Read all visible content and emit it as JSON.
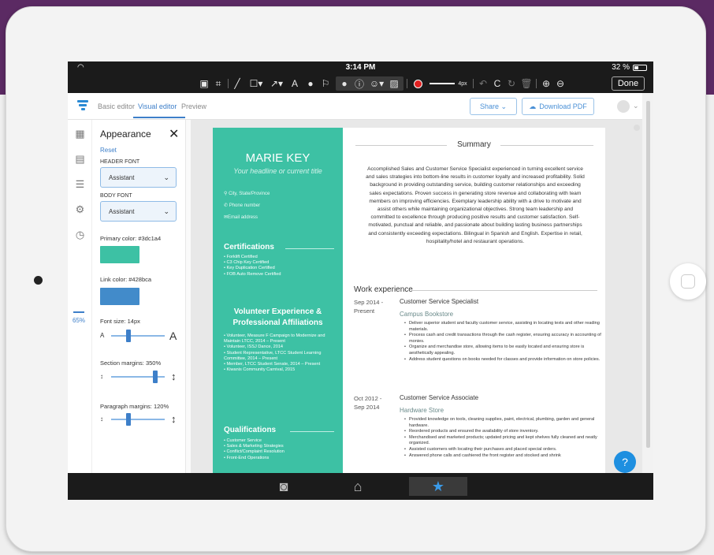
{
  "status": {
    "time": "3:14 PM",
    "battery": "32 %"
  },
  "toolbar": {
    "tools": [
      "select-icon",
      "crop-icon",
      "pen-icon",
      "rect-icon",
      "arrow-icon",
      "text-icon",
      "fill-icon",
      "highlight-icon",
      "comment-icon",
      "info-icon",
      "emoji-icon",
      "image-icon",
      "color-icon",
      "stroke-icon",
      "undo-icon",
      "redo-icon",
      "rotate-icon",
      "trash-icon",
      "zoom-in-icon",
      "zoom-out-icon"
    ],
    "stroke_label": "4px",
    "done_label": "Done",
    "accent_color": "#e02020"
  },
  "app": {
    "tabs": [
      "Basic editor",
      "Visual editor",
      "Preview"
    ],
    "share_label": "Share",
    "download_label": "Download PDF"
  },
  "rail": {
    "zoom": "65%"
  },
  "panel": {
    "title": "Appearance",
    "reset": "Reset",
    "header_font_label": "HEADER FONT",
    "header_font": "Assistant",
    "body_font_label": "BODY FONT",
    "body_font": "Assistant",
    "primary_color_label": "Primary color: #3dc1a4",
    "primary_color": "#3dc1a4",
    "link_color_label": "Link color: #428bca",
    "link_color": "#428bca",
    "font_size_label": "Font size: 14px",
    "font_size_fraction": 0.3,
    "section_margins_label": "Section margins: 350%",
    "section_margins_fraction": 0.85,
    "paragraph_margins_label": "Paragraph margins: 120%",
    "paragraph_margins_fraction": 0.3,
    "small_a": "A",
    "big_a": "A"
  },
  "resume": {
    "name": "MARIE KEY",
    "headline": "Your headline or current title",
    "contact": [
      "City, State/Province",
      "Phone number",
      "Email address"
    ],
    "certifications_title": "Certifications",
    "certifications": [
      "Forklift Certified",
      "C3 Chip Key Certified",
      "Key Duplication Certified",
      "FOB Auto Remove Certified"
    ],
    "volunteer_title_1": "Volunteer Experience &",
    "volunteer_title_2": "Professional Affiliations",
    "volunteer": [
      "Volunteer, Measure F Campaign to Modernize and Maintain LTCC, 2014 – Present",
      "Volunteer, ISSJ Dance, 2014",
      "Student Representative, LTCC Student Learning Committee, 2014 – Present",
      "Member, LTCC Student Senate, 2014 – Present",
      "Kiwanis Community Carnival, 2015"
    ],
    "qualifications_title": "Qualifications",
    "qualifications": [
      "Customer Service",
      "Sales & Marketing Strategies",
      "Conflict/Complaint Resolution",
      "Front-End Operations"
    ],
    "summary_title": "Summary",
    "summary": "Accomplished Sales and Customer Service Specialist experienced in turning excellent service and sales strategies into bottom-line results in customer loyalty and increased profitability. Solid background in providing outstanding service, building customer relationships and exceeding sales expectations. Proven success in generating store revenue and collaborating with team members on improving efficiencies. Exemplary leadership ability with a drive to motivate and assist others while maintaining organizational objectives. Strong team leadership and committed to excellence through producing positive results and customer satisfaction. Self-motivated, punctual and reliable, and passionate about building lasting business partnerships and consistently exceeding expectations. Bilingual in Spanish and English. Expertise in retail, hospitality/hotel and restaurant operations.",
    "work_title": "Work experience",
    "jobs": [
      {
        "date1": "Sep 2014 -",
        "date2": "Present",
        "title": "Customer Service Specialist",
        "company": "Campus Bookstore",
        "bullets": [
          "Deliver superior student and faculty customer service, assisting in locating texts and other reading materials.",
          "Process cash and credit transactions through the cash register, ensuring accuracy in accounting of monies.",
          "Organize and merchandise store, allowing items to be easily located and ensuring store is aesthetically appealing.",
          "Address student questions on books needed for classes and provide information on store policies."
        ]
      },
      {
        "date1": "Oct 2012 -",
        "date2": "Sep 2014",
        "title": "Customer Service Associate",
        "company": "Hardware Store",
        "bullets": [
          "Provided knowledge on tools, cleaning supplies, paint, electrical, plumbing, garden and general hardware.",
          "Reordered products and ensured the availability of store inventory.",
          "Merchandised and marketed products; updated pricing and kept shelves fully cleaned and neatly organized.",
          "Assisted customers with locating their purchases and placed special orders.",
          "Answered phone calls and cashiered the front register and stocked and shrink"
        ]
      }
    ]
  },
  "help_label": "?"
}
